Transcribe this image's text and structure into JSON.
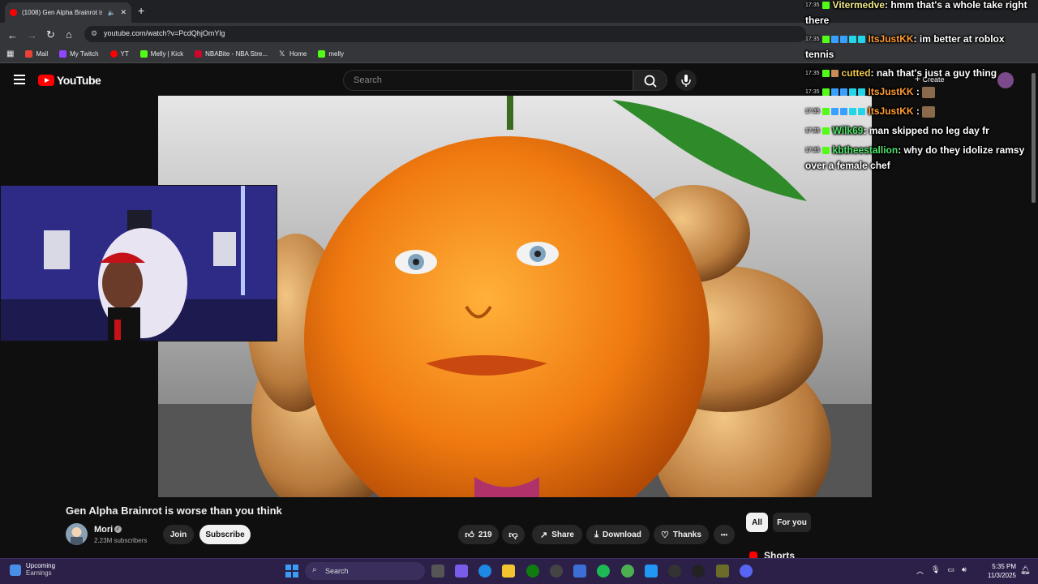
{
  "browser": {
    "tab_title": "(1008) Gen Alpha Brainrot is",
    "new_tab": "+",
    "url": "youtube.com/watch?v=PcdQhjOmYlg",
    "bookmarks": [
      {
        "label": "Mail",
        "color": "#ea4335"
      },
      {
        "label": "My Twitch",
        "color": "#9146ff"
      },
      {
        "label": "YT",
        "color": "#ff0000"
      },
      {
        "label": "Melly | Kick",
        "color": "#53fc18"
      },
      {
        "label": "NBABite - NBA Stre...",
        "color": "#c9082a"
      },
      {
        "label": "Home",
        "color": "#ffffff"
      },
      {
        "label": "melly",
        "color": "#53fc18"
      }
    ]
  },
  "youtube": {
    "logo_text": "YouTube",
    "search_placeholder": "Search",
    "create_label": "Create",
    "video_title": "Gen Alpha Brainrot is worse than you think",
    "channel_name": "Mori",
    "subscribers": "2.23M subscribers",
    "join_label": "Join",
    "subscribe_label": "Subscribe",
    "like_count": "219",
    "share_label": "Share",
    "download_label": "Download",
    "thanks_label": "Thanks",
    "more_label": "•••",
    "chips": [
      "All",
      "For you"
    ],
    "shorts_label": "Shorts"
  },
  "chat": [
    {
      "time": "17:35",
      "user": "Vitermedve",
      "color": "#f2e98a",
      "text": ": hmm that's a whole take right there",
      "badges": [
        "kick"
      ],
      "emote": false
    },
    {
      "time": "17:35",
      "user": "ItsJustKK",
      "color": "#ff9a2f",
      "text": ": im better at roblox tennis",
      "badges": [
        "kick",
        "blue",
        "blue",
        "cyan",
        "cyan"
      ],
      "emote": false
    },
    {
      "time": "17:35",
      "user": "cutted",
      "color": "#f2c84a",
      "text": ": nah that's just a guy thing",
      "badges": [
        "kick",
        "blue"
      ],
      "emote": false
    },
    {
      "time": "17:35",
      "user": "ItsJustKK",
      "color": "#ff9a2f",
      "text": " :",
      "badges": [
        "kick",
        "blue",
        "blue",
        "cyan",
        "cyan"
      ],
      "emote": true
    },
    {
      "time": "17:35",
      "user": "ItsJustKK",
      "color": "#ff9a2f",
      "text": " :",
      "badges": [
        "kick",
        "blue",
        "blue",
        "cyan",
        "cyan"
      ],
      "emote": true
    },
    {
      "time": "17:35",
      "user": "Wilk69",
      "color": "#4ee66a",
      "text": ": man skipped no leg day fr",
      "badges": [
        "kick"
      ],
      "emote": false
    },
    {
      "time": "17:35",
      "user": "kbtheestallion",
      "color": "#4ee66a",
      "text": ": why do they idolize ramsy over a female chef",
      "badges": [
        "kick"
      ],
      "emote": false
    }
  ],
  "taskbar": {
    "weather_title": "Upcoming",
    "weather_sub": "Earnings",
    "search_label": "Search",
    "time": "5:35 PM",
    "date": "11/3/2025"
  }
}
